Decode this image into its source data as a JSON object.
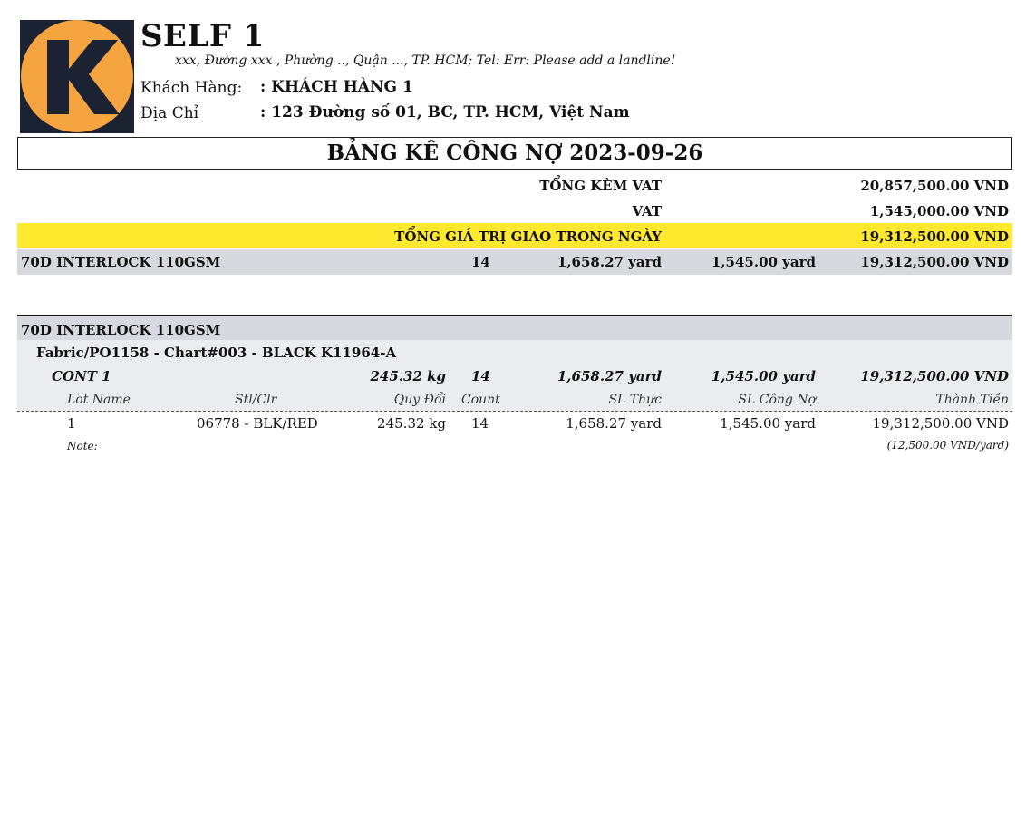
{
  "colors": {
    "logo_orange": "#f6a440",
    "logo_dark": "#1b2333",
    "highlight_yellow": "#ffe92e",
    "row_gray": "#d7d9de",
    "row_lightgray": "#ebecef"
  },
  "header": {
    "logo_letter": "K",
    "company_name": "SELF 1",
    "address_line": "xxx, Đường xxx , Phường .., Quận ..., TP. HCM; Tel: Err: Please add a landline!",
    "customer_label": "Khách Hàng:",
    "customer_value": ": KHÁCH HÀNG 1",
    "address_label": "Địa Chỉ",
    "address_value": ": 123 Đường số 01, BC, TP. HCM, Việt Nam"
  },
  "title": "BẢNG KÊ CÔNG NỢ 2023-09-26",
  "summary": {
    "total_with_vat_label": "TỔNG KÈM VAT",
    "total_with_vat_value": "20,857,500.00 VND",
    "vat_label": "VAT",
    "vat_value": "1,545,000.00 VND",
    "daily_total_label": "TỔNG GIÁ TRỊ GIAO TRONG NGÀY",
    "daily_total_value": "19,312,500.00 VND"
  },
  "product_summary": {
    "name": "70D INTERLOCK 110GSM",
    "count": "14",
    "sl_thuc": "1,658.27 yard",
    "sl_cong_no": "1,545.00 yard",
    "amount": "19,312,500.00 VND"
  },
  "detail": {
    "product_name": "70D INTERLOCK 110GSM",
    "fabric_line": "Fabric/PO1158 - Chart#003 - BLACK K11964-A",
    "cont": {
      "name": "CONT 1",
      "weight": "245.32 kg",
      "count": "14",
      "sl_thuc": "1,658.27 yard",
      "sl_cong_no": "1,545.00 yard",
      "amount": "19,312,500.00 VND"
    },
    "columns": {
      "lot_name": "Lot Name",
      "stl_clr": "Stl/Clr",
      "quy_doi": "Quy Đổi",
      "count": "Count",
      "sl_thuc": "SL Thực",
      "sl_cong_no": "SL Công Nợ",
      "thanh_tien": "Thành Tiền"
    },
    "rows": [
      {
        "lot_name": "1",
        "stl_clr": "06778 - BLK/RED",
        "quy_doi": "245.32 kg",
        "count": "14",
        "sl_thuc": "1,658.27 yard",
        "sl_cong_no": "1,545.00 yard",
        "thanh_tien": "19,312,500.00 VND"
      }
    ],
    "note_label": "Note:",
    "unit_price": "(12,500.00 VND/yard)"
  }
}
